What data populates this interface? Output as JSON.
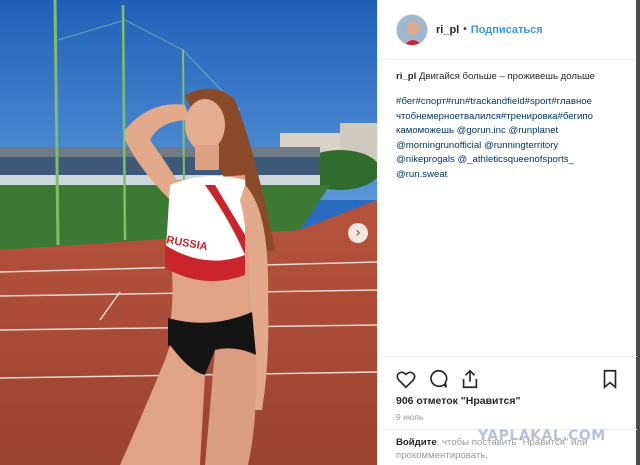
{
  "header": {
    "username": "ri_pl",
    "separator": "•",
    "follow_label": "Подписаться"
  },
  "caption": {
    "username": "ri_pl",
    "text": "Двигайся больше – проживешь дольше"
  },
  "hashtags": "#бег#спорт#run#trackandfield#sport#главное чтобнемерноетвалился#тренировка#бегипо камоможешь @gorun.inc @runplanet @morningrunofficial @runningterritory @nikeprogals @_athleticsqueenofsports_ @run.sweat",
  "hashtag_lines": [
    "#бег#спорт#run#trackandfield#sport#главное",
    "чтобнемерноетвалился#тренировка#бегипо",
    "камоможешь @gorun.inc @runplanet",
    "@morningrunofficial @runningterritory",
    "@nikeprogals @_athleticsqueenofsports_",
    "@run.sweat"
  ],
  "photo": {
    "jersey_text": "RUSSIA",
    "carousel_icon": "chevron-right-icon"
  },
  "actions": {
    "like_icon": "heart-icon",
    "comment_icon": "comment-icon",
    "share_icon": "share-icon",
    "save_icon": "bookmark-icon",
    "likes_text": "906 отметок \"Нравится\"",
    "date_text": "9 июль"
  },
  "comment_bar": {
    "login_label": "Войдите",
    "rest_text": ", чтобы поставить \"Нравится\" или прокомментировать."
  },
  "watermark": "YAPLAKAL.COM",
  "colors": {
    "link": "#3897f0",
    "hashtag": "#003569",
    "sky": "#2a6bbf",
    "track": "#b5523f"
  }
}
